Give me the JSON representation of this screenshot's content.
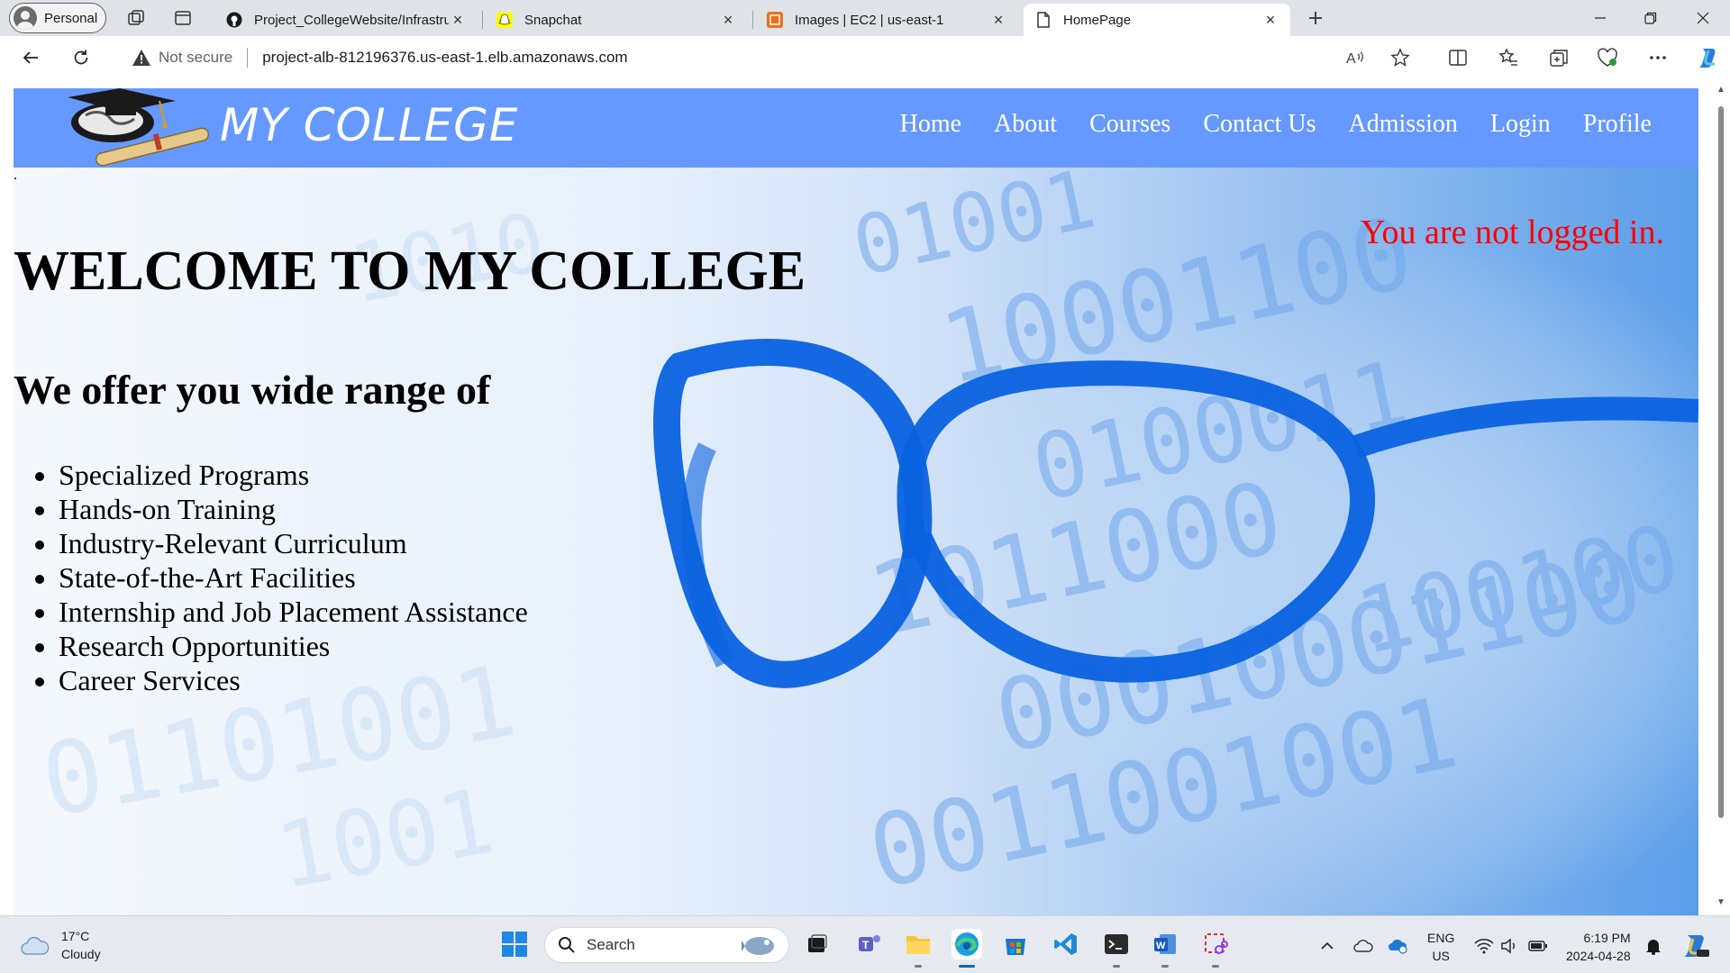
{
  "browser": {
    "profile_label": "Personal",
    "tabs": [
      {
        "title": "Project_CollegeWebsite/Infrastru",
        "icon": "github-icon"
      },
      {
        "title": "Snapchat",
        "icon": "snapchat-icon"
      },
      {
        "title": "Images | EC2 | us-east-1",
        "icon": "aws-icon"
      },
      {
        "title": "HomePage",
        "icon": "page-icon"
      }
    ],
    "address": {
      "security_label": "Not secure",
      "url": "project-alb-812196376.us-east-1.elb.amazonaws.com"
    }
  },
  "site": {
    "name": "MY COLLEGE",
    "nav": [
      "Home",
      "About",
      "Courses",
      "Contact Us",
      "Admission",
      "Login",
      "Profile"
    ],
    "dot": ".",
    "welcome": "WELCOME TO MY COLLEGE",
    "offer": "We offer you wide range of",
    "programs": [
      "Specialized Programs",
      "Hands-on Training",
      "Industry-Relevant Curriculum",
      "State-of-the-Art Facilities",
      "Internship and Job Placement Assistance",
      "Research Opportunities",
      "Career Services"
    ],
    "login_status": "You are not logged in.",
    "colors": {
      "header": "#6699ff",
      "status": "#ff0000"
    }
  },
  "taskbar": {
    "weather": {
      "temp": "17°C",
      "condition": "Cloudy"
    },
    "search_placeholder": "Search",
    "language": {
      "lang": "ENG",
      "region": "US"
    },
    "clock": {
      "time": "6:19 PM",
      "date": "2024-04-28"
    }
  }
}
